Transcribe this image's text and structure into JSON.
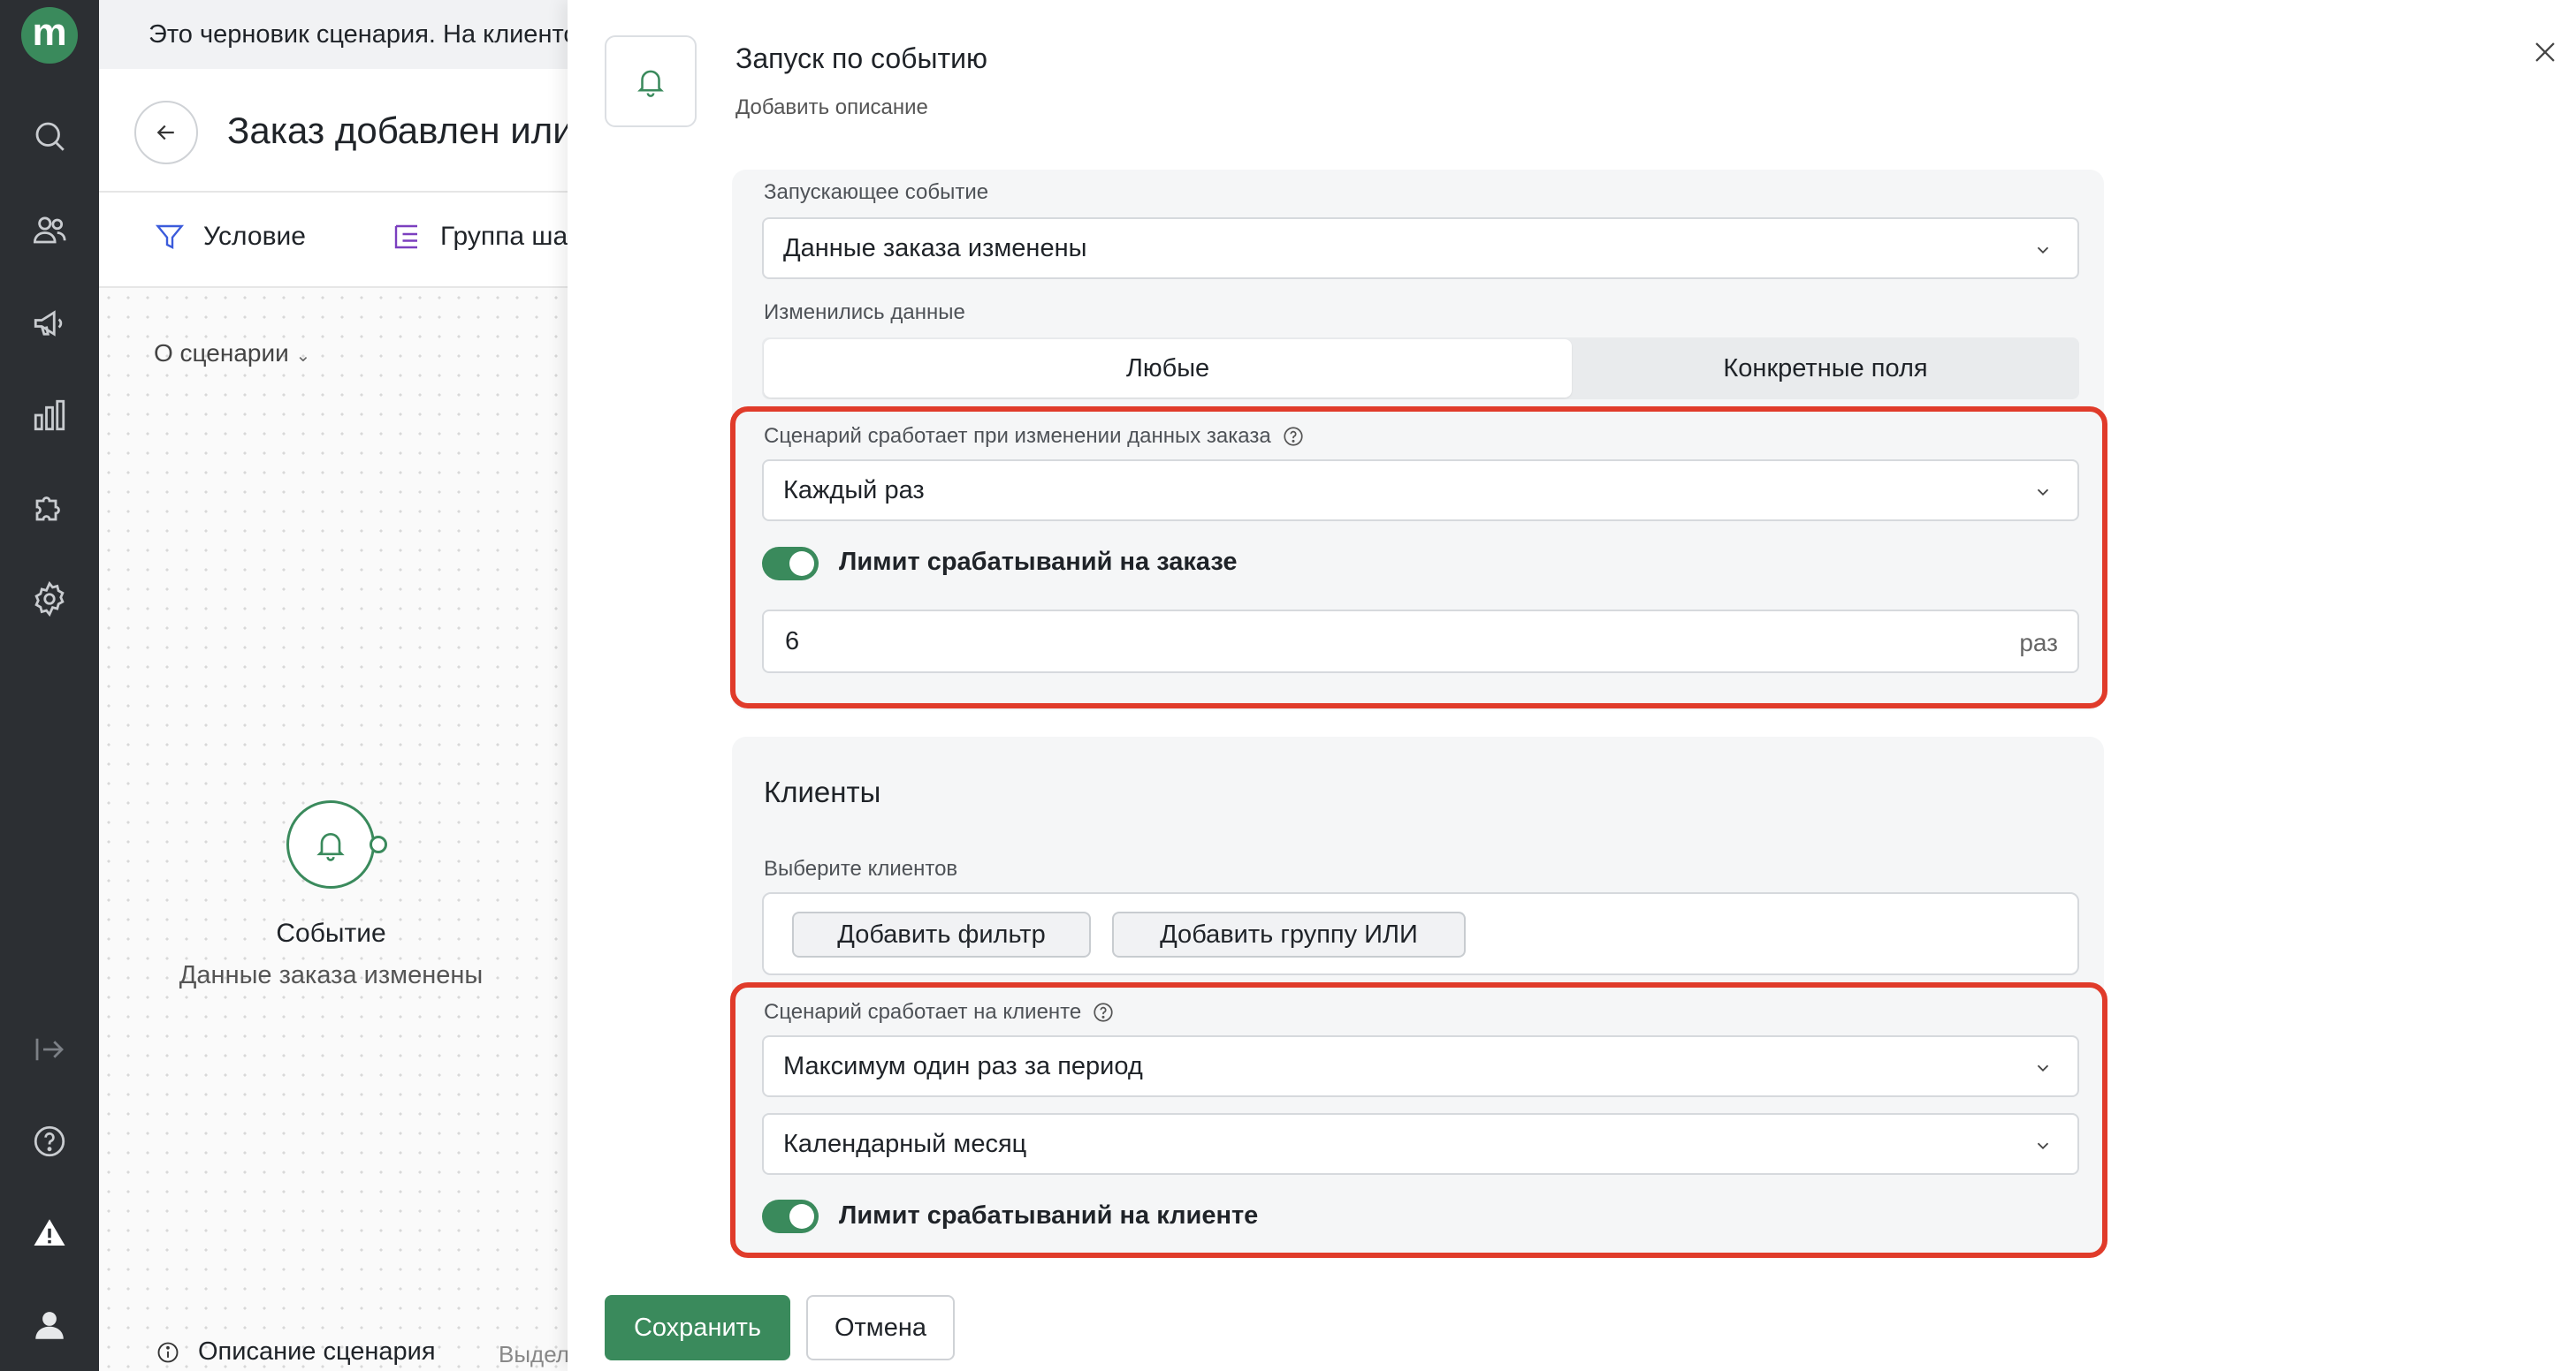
{
  "rail": {
    "logo_letter": "m",
    "icons": [
      "search-icon",
      "users-icon",
      "megaphone-icon",
      "chart-icon",
      "puzzle-icon",
      "gear-icon",
      "expand-icon",
      "help-icon",
      "warning-icon",
      "profile-icon"
    ]
  },
  "background": {
    "banner": "Это черновик сценария. На клиентов он не действует.",
    "page_title": "Заказ добавлен или изменён",
    "toolbar": {
      "condition": "Условие",
      "step_group": "Группа шагов"
    },
    "about": "О сценарии",
    "node": {
      "title": "Событие",
      "subtitle": "Данные заказа изменены"
    },
    "bottom": {
      "description": "Описание сценария",
      "highlight": "Выделить"
    }
  },
  "modal": {
    "title": "Запуск по событию",
    "description": "Добавить описание",
    "trigger": {
      "event_label": "Запускающее событие",
      "event_value": "Данные заказа изменены",
      "changed_label": "Изменились данные",
      "segments": [
        "Любые",
        "Конкретные поля"
      ],
      "order_rule_label": "Сценарий сработает при изменении данных заказа",
      "order_rule_value": "Каждый раз",
      "order_limit_label": "Лимит срабатываний на заказе",
      "order_limit_value": "6",
      "order_limit_suffix": "раз"
    },
    "clients": {
      "heading": "Клиенты",
      "select_label": "Выберите клиентов",
      "add_filter": "Добавить фильтр",
      "add_or_group": "Добавить группу ИЛИ",
      "client_rule_label": "Сценарий сработает на клиенте",
      "client_rule_value": "Максимум один раз за период",
      "period_value": "Календарный месяц",
      "client_limit_label": "Лимит срабатываний на клиенте"
    },
    "buttons": {
      "save": "Сохранить",
      "cancel": "Отмена"
    }
  },
  "colors": {
    "accent": "#3a8a5c",
    "highlight": "#e03b2a",
    "rail": "#2c2f33"
  }
}
